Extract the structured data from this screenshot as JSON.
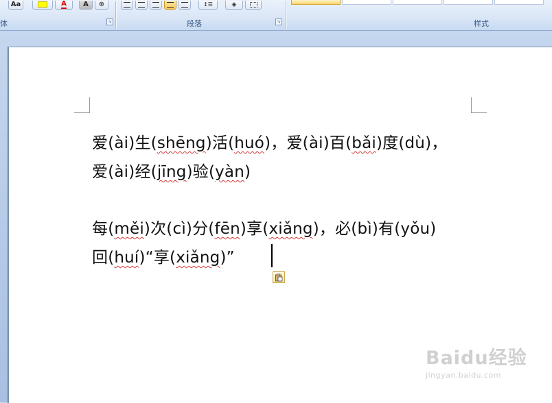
{
  "ribbon": {
    "font_group": {
      "label": "体",
      "font_size_btn": "Aa",
      "highlight_btn": "ab",
      "font_color_btn": "A",
      "char_shading_btn": "A",
      "enclose_btn": "⊕"
    },
    "paragraph_group": {
      "label": "段落"
    },
    "styles_group": {
      "label": "样式"
    }
  },
  "document": {
    "paragraphs": [
      {
        "lines": [
          [
            {
              "t": "爱("
            },
            {
              "t": "ài",
              "sq": false
            },
            {
              "t": ")生("
            },
            {
              "t": "shēng",
              "sq": true
            },
            {
              "t": ")活("
            },
            {
              "t": "huó",
              "sq": true
            },
            {
              "t": ")，爱("
            },
            {
              "t": "ài",
              "sq": false
            },
            {
              "t": ")百("
            },
            {
              "t": "bǎi",
              "sq": true
            },
            {
              "t": ")度("
            },
            {
              "t": "dù",
              "sq": false
            },
            {
              "t": ")，"
            }
          ],
          [
            {
              "t": "爱("
            },
            {
              "t": "ài",
              "sq": false
            },
            {
              "t": ")经("
            },
            {
              "t": "jīng",
              "sq": true
            },
            {
              "t": ")验("
            },
            {
              "t": "yàn",
              "sq": true
            },
            {
              "t": ")"
            }
          ]
        ]
      },
      {
        "lines": [
          [
            {
              "t": "每("
            },
            {
              "t": "měi",
              "sq": true
            },
            {
              "t": ")次("
            },
            {
              "t": "cì",
              "sq": false
            },
            {
              "t": ")分("
            },
            {
              "t": "fēn",
              "sq": true
            },
            {
              "t": ")享("
            },
            {
              "t": "xiǎng",
              "sq": true
            },
            {
              "t": ")，必("
            },
            {
              "t": "bì",
              "sq": false
            },
            {
              "t": ")有("
            },
            {
              "t": "yǒu",
              "sq": false
            },
            {
              "t": ")"
            }
          ],
          [
            {
              "t": "回("
            },
            {
              "t": "huí",
              "sq": true
            },
            {
              "t": ")“享("
            },
            {
              "t": "xiǎng",
              "sq": true
            },
            {
              "t": ")”"
            }
          ]
        ]
      }
    ]
  },
  "watermark": {
    "brand": "Baidu经验",
    "url": "jingyan.baidu.com"
  },
  "colors": {
    "ribbon_bg": "#dbe7f7",
    "highlight_yellow": "#ffff00",
    "font_red": "#e00000",
    "spell_squiggle": "#d83a3a"
  },
  "icons": {
    "paste_options": "paste-options-icon",
    "dialog_launcher": "dialog-launcher-icon"
  }
}
